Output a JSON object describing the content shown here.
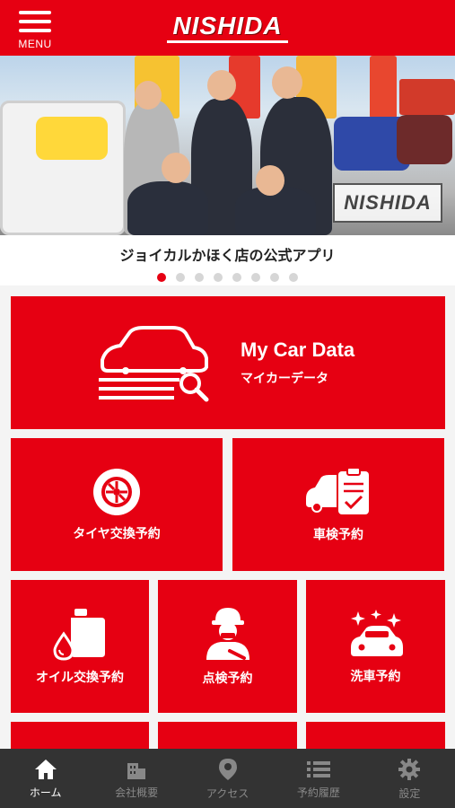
{
  "header": {
    "menu_label": "MENU",
    "logo_text": "NISHIDA"
  },
  "hero": {
    "logo_text": "NISHIDA",
    "caption": "ジョイカルかほく店の公式アプリ",
    "slide_count": 8,
    "active_slide": 1
  },
  "tiles": {
    "my_car": {
      "title": "My Car Data",
      "subtitle": "マイカーデータ"
    },
    "tire": {
      "label": "タイヤ交換予約"
    },
    "inspection_car": {
      "label": "車検予約"
    },
    "oil": {
      "label": "オイル交換予約"
    },
    "check": {
      "label": "点検予約"
    },
    "wash": {
      "label": "洗車予約"
    }
  },
  "bottom_nav": {
    "items": [
      {
        "label": "ホーム",
        "icon": "home-icon",
        "active": true
      },
      {
        "label": "会社概要",
        "icon": "building-icon",
        "active": false
      },
      {
        "label": "アクセス",
        "icon": "map-pin-icon",
        "active": false
      },
      {
        "label": "予約履歴",
        "icon": "list-icon",
        "active": false
      },
      {
        "label": "設定",
        "icon": "gear-icon",
        "active": false
      }
    ]
  },
  "colors": {
    "brand_red": "#e60012",
    "nav_bg": "#333333",
    "dot_active": "#e60012",
    "dot_inactive": "#d6d6d6"
  }
}
